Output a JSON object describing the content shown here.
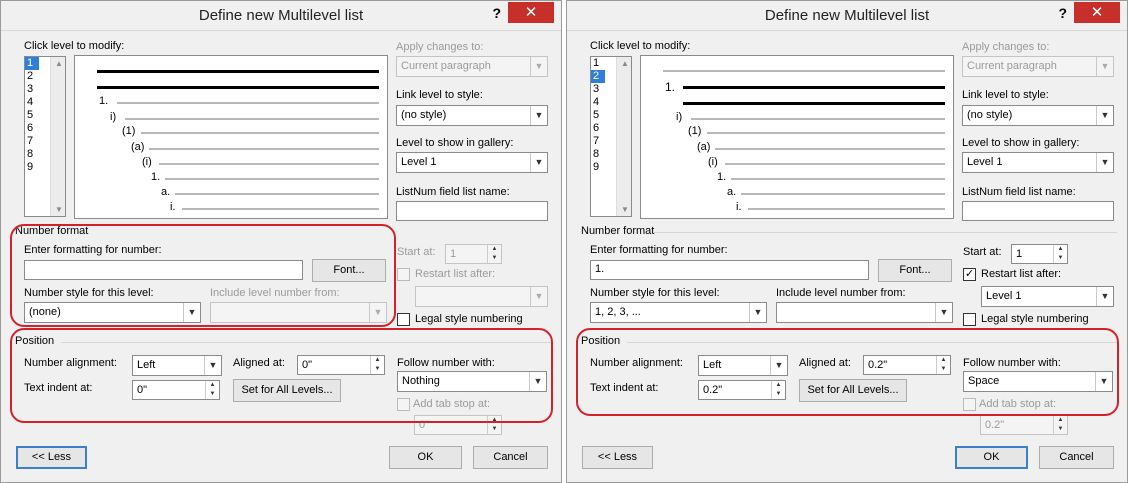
{
  "left": {
    "title": "Define new Multilevel list",
    "help": "?",
    "close": "✕",
    "click_level_label": "Click level to modify:",
    "levels": [
      "1",
      "2",
      "3",
      "4",
      "5",
      "6",
      "7",
      "8",
      "9"
    ],
    "preview_labels": [
      "1.",
      "i)",
      "(1)",
      "(a)",
      "(i)",
      "1.",
      "a.",
      "i."
    ],
    "apply_changes_label": "Apply changes to:",
    "apply_changes_value": "Current paragraph",
    "link_style_label": "Link level to style:",
    "link_style_value": "(no style)",
    "gallery_label": "Level to show in gallery:",
    "gallery_value": "Level 1",
    "listnum_label": "ListNum field list name:",
    "number_format_label": "Number format",
    "enter_format_label": "Enter formatting for number:",
    "format_value": "",
    "font_button": "Font...",
    "number_style_label": "Number style for this level:",
    "number_style_value": "(none)",
    "include_level_label": "Include level number from:",
    "start_at_label": "Start at:",
    "start_at_value": "1",
    "restart_label": "Restart list after:",
    "legal_label": "Legal style numbering",
    "position_label": "Position",
    "alignment_label": "Number alignment:",
    "alignment_value": "Left",
    "aligned_at_label": "Aligned at:",
    "aligned_at_value": "0\"",
    "text_indent_label": "Text indent at:",
    "text_indent_value": "0\"",
    "set_all_button": "Set for All Levels...",
    "follow_label": "Follow number with:",
    "follow_value": "Nothing",
    "tab_stop_label": "Add tab stop at:",
    "tab_stop_value": "0\"",
    "less_button": "<< Less",
    "ok_button": "OK",
    "cancel_button": "Cancel"
  },
  "right": {
    "title": "Define new Multilevel list",
    "help": "?",
    "close": "✕",
    "click_level_label": "Click level to modify:",
    "levels": [
      "1",
      "2",
      "3",
      "4",
      "5",
      "6",
      "7",
      "8",
      "9"
    ],
    "preview_labels": [
      "1.",
      "i)",
      "(1)",
      "(a)",
      "(i)",
      "1.",
      "a.",
      "i."
    ],
    "apply_changes_label": "Apply changes to:",
    "apply_changes_value": "Current paragraph",
    "link_style_label": "Link level to style:",
    "link_style_value": "(no style)",
    "gallery_label": "Level to show in gallery:",
    "gallery_value": "Level 1",
    "listnum_label": "ListNum field list name:",
    "number_format_label": "Number format",
    "enter_format_label": "Enter formatting for number:",
    "format_value": "1.",
    "font_button": "Font...",
    "number_style_label": "Number style for this level:",
    "number_style_value": "1, 2, 3, ...",
    "include_level_label": "Include level number from:",
    "start_at_label": "Start at:",
    "start_at_value": "1",
    "restart_label": "Restart list after:",
    "restart_value": "Level 1",
    "legal_label": "Legal style numbering",
    "position_label": "Position",
    "alignment_label": "Number alignment:",
    "alignment_value": "Left",
    "aligned_at_label": "Aligned at:",
    "aligned_at_value": "0.2\"",
    "text_indent_label": "Text indent at:",
    "text_indent_value": "0.2\"",
    "set_all_button": "Set for All Levels...",
    "follow_label": "Follow number with:",
    "follow_value": "Space",
    "tab_stop_label": "Add tab stop at:",
    "tab_stop_value": "0.2\"",
    "less_button": "<< Less",
    "ok_button": "OK",
    "cancel_button": "Cancel"
  },
  "colors": {
    "accent": "#d2232a",
    "selection": "#2f7fd8",
    "close": "#c7302a"
  }
}
